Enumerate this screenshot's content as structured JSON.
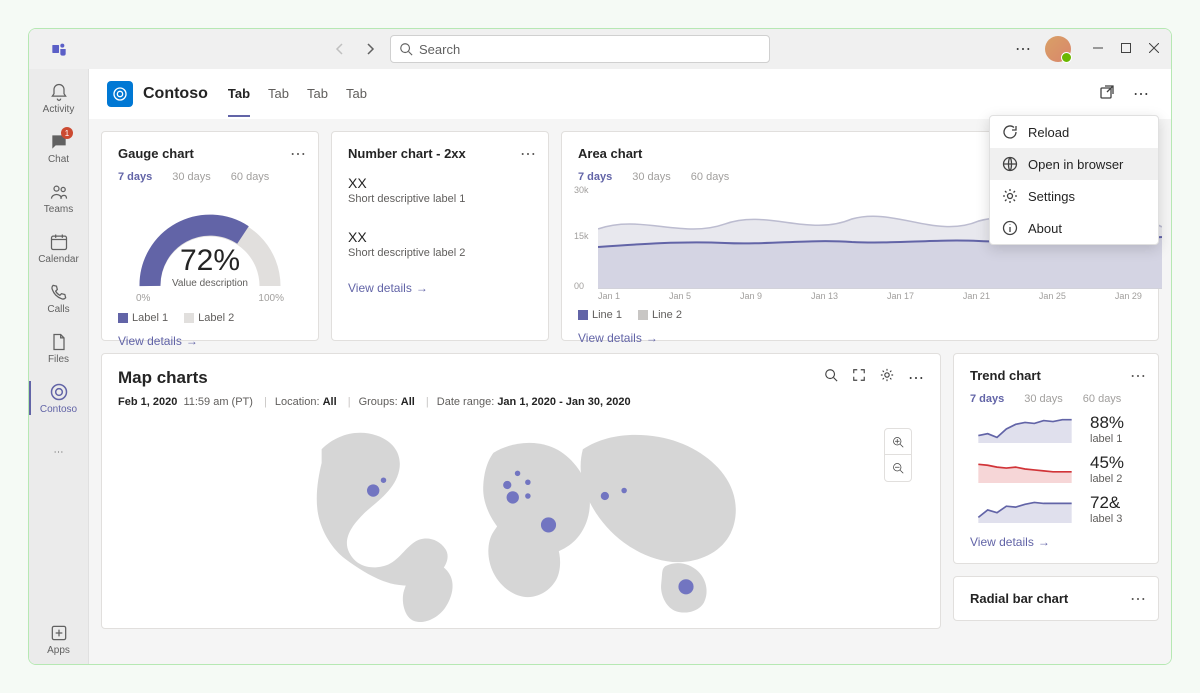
{
  "titlebar": {
    "search_placeholder": "Search"
  },
  "rail": {
    "items": [
      {
        "label": "Activity"
      },
      {
        "label": "Chat",
        "badge": "1"
      },
      {
        "label": "Teams"
      },
      {
        "label": "Calendar"
      },
      {
        "label": "Calls"
      },
      {
        "label": "Files"
      },
      {
        "label": "Contoso"
      }
    ],
    "apps": "Apps"
  },
  "header": {
    "app_name": "Contoso",
    "tabs": [
      "Tab",
      "Tab",
      "Tab",
      "Tab"
    ]
  },
  "dropdown": {
    "items": [
      "Reload",
      "Open in browser",
      "Settings",
      "About"
    ]
  },
  "gauge": {
    "title": "Gauge chart",
    "days": [
      "7 days",
      "30 days",
      "60 days"
    ],
    "value": "72%",
    "desc": "Value description",
    "min": "0%",
    "max": "100%",
    "legend": [
      "Label 1",
      "Label 2"
    ],
    "link": "View details"
  },
  "number": {
    "title": "Number chart - 2xx",
    "items": [
      {
        "v": "XX",
        "l": "Short descriptive label 1"
      },
      {
        "v": "XX",
        "l": "Short descriptive label 2"
      }
    ],
    "link": "View details"
  },
  "area": {
    "title": "Area chart",
    "days": [
      "7 days",
      "30 days",
      "60 days"
    ],
    "yticks": [
      "30k",
      "15k",
      "00"
    ],
    "xticks": [
      "Jan 1",
      "Jan 5",
      "Jan 9",
      "Jan 13",
      "Jan 17",
      "Jan 21",
      "Jan 25",
      "Jan 29"
    ],
    "legend": [
      "Line 1",
      "Line 2"
    ],
    "link": "View details"
  },
  "map": {
    "title": "Map charts",
    "date": "Feb 1, 2020",
    "time": "11:59 am (PT)",
    "loc_label": "Location:",
    "loc_val": "All",
    "grp_label": "Groups:",
    "grp_val": "All",
    "range_label": "Date range:",
    "range_val": "Jan 1, 2020 - Jan 30, 2020"
  },
  "trend": {
    "title": "Trend chart",
    "days": [
      "7 days",
      "30 days",
      "60 days"
    ],
    "series": [
      {
        "pv": "88%",
        "pl": "label 1"
      },
      {
        "pv": "45%",
        "pl": "label 2"
      },
      {
        "pv": "72&",
        "pl": "label 3"
      }
    ],
    "link": "View details"
  },
  "radial": {
    "title": "Radial bar chart"
  },
  "chart_data": {
    "gauge": {
      "type": "gauge",
      "value": 72,
      "min": 0,
      "max": 100,
      "series": [
        {
          "name": "Label 1"
        },
        {
          "name": "Label 2"
        }
      ]
    },
    "area": {
      "type": "area",
      "ylim": [
        0,
        30000
      ],
      "x": [
        "Jan 1",
        "Jan 5",
        "Jan 9",
        "Jan 13",
        "Jan 17",
        "Jan 21",
        "Jan 25",
        "Jan 29"
      ],
      "series": [
        {
          "name": "Line 1",
          "values": [
            13000,
            14000,
            14500,
            14000,
            14500,
            15000,
            14500,
            15500
          ]
        },
        {
          "name": "Line 2",
          "values": [
            18000,
            20000,
            17000,
            21000,
            18000,
            22000,
            19000,
            20000
          ]
        }
      ]
    },
    "trend": {
      "type": "sparkline",
      "series": [
        {
          "name": "label 1",
          "color": "#6264A7",
          "values": [
            50,
            52,
            48,
            60,
            75,
            80,
            78,
            85,
            84,
            88
          ]
        },
        {
          "name": "label 2",
          "color": "#d13438",
          "values": [
            60,
            58,
            55,
            52,
            53,
            50,
            48,
            47,
            45,
            45
          ]
        },
        {
          "name": "label 3",
          "color": "#6264A7",
          "values": [
            40,
            55,
            50,
            65,
            62,
            70,
            74,
            73,
            72,
            72
          ]
        }
      ]
    }
  }
}
